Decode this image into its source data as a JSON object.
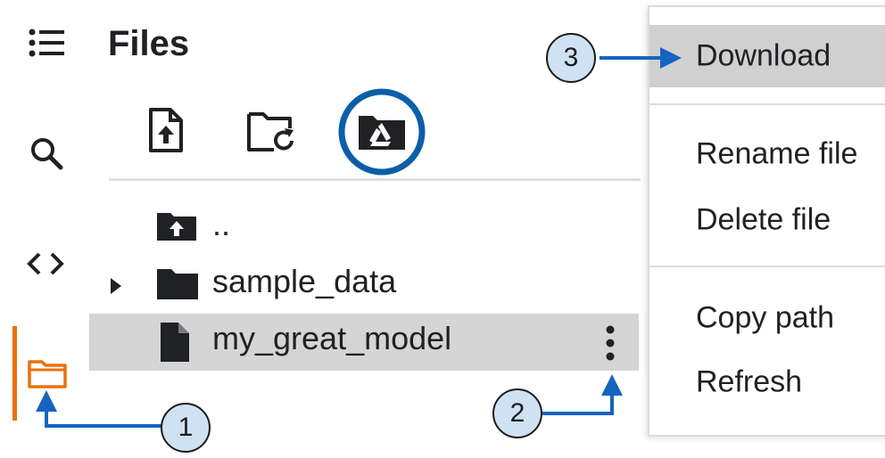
{
  "header": {
    "title": "Files"
  },
  "tree": {
    "parent": "..",
    "folder": "sample_data",
    "file": "my_great_model"
  },
  "menu": {
    "items": [
      {
        "label": "Download",
        "highlighted": true
      },
      {
        "label": "Rename file"
      },
      {
        "label": "Delete file"
      },
      {
        "label": "Copy path"
      },
      {
        "label": "Refresh"
      }
    ]
  },
  "callouts": {
    "one": "1",
    "two": "2",
    "three": "3"
  },
  "colors": {
    "accent": "#e8710a",
    "callout_arrow": "#1565c0",
    "callout_fill": "#cfe2f3",
    "selected_row": "#d5d5d5",
    "highlight_ring": "#0b5ea8"
  }
}
